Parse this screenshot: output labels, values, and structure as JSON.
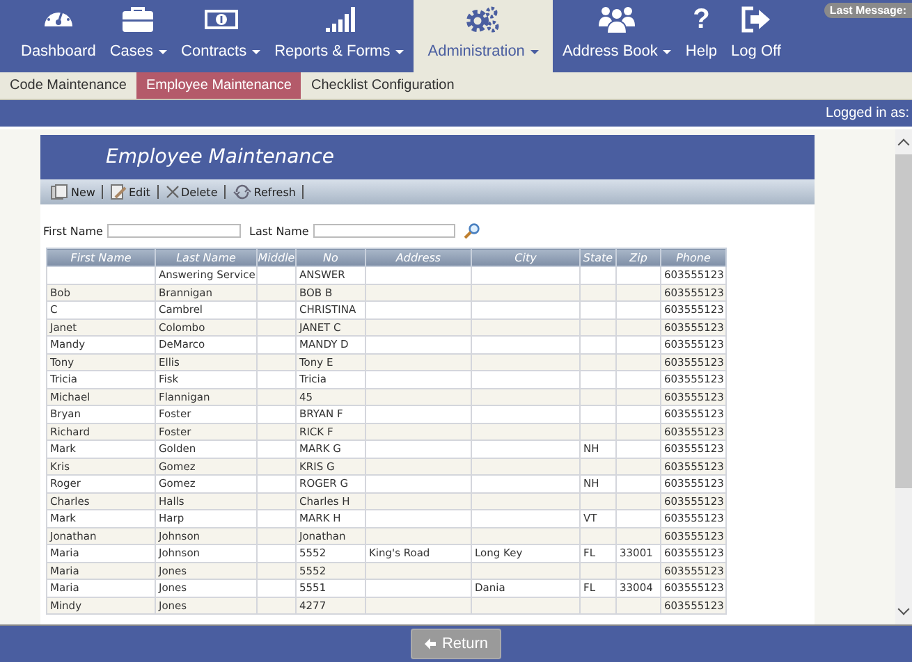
{
  "nav": {
    "items": [
      {
        "label": "Dashboard",
        "caret": false,
        "selected": false
      },
      {
        "label": "Cases",
        "caret": true,
        "selected": false
      },
      {
        "label": "Contracts",
        "caret": true,
        "selected": false
      },
      {
        "label": "Reports & Forms",
        "caret": true,
        "selected": false
      },
      {
        "label": "Administration",
        "caret": true,
        "selected": true
      },
      {
        "label": "Address Book",
        "caret": true,
        "selected": false
      },
      {
        "label": "Help",
        "glyph": "?",
        "caret": false,
        "selected": false
      },
      {
        "label": "Log Off",
        "caret": false,
        "selected": false
      }
    ],
    "last_message": "Last Message:"
  },
  "subnav": [
    {
      "label": "Code Maintenance",
      "selected": false
    },
    {
      "label": "Employee Maintenance",
      "selected": true
    },
    {
      "label": "Checklist Configuration",
      "selected": false
    }
  ],
  "user_bar": {
    "text": "Logged in as:"
  },
  "panel": {
    "title": "Employee Maintenance",
    "toolbar": [
      {
        "label": "New"
      },
      {
        "label": "Edit"
      },
      {
        "label": "Delete"
      },
      {
        "label": "Refresh"
      }
    ],
    "filters": [
      {
        "label": "First Name"
      },
      {
        "label": "Last Name"
      }
    ],
    "table": {
      "columns": [
        "First Name",
        "Last Name",
        "Middle",
        "No",
        "Address",
        "City",
        "State",
        "Zip",
        "Phone"
      ],
      "rows": [
        {
          "last_name": "Answering Service",
          "no": "ANSWER",
          "phone": "603555123"
        },
        {
          "first_name": "Bob",
          "last_name": "Brannigan",
          "no": "BOB B",
          "phone": "603555123"
        },
        {
          "first_name": "C",
          "last_name": "Cambrel",
          "no": "CHRISTINA",
          "phone": "603555123"
        },
        {
          "first_name": "Janet",
          "last_name": "Colombo",
          "no": "JANET C",
          "phone": "603555123"
        },
        {
          "first_name": "Mandy",
          "last_name": "DeMarco",
          "no": "MANDY D",
          "phone": "603555123"
        },
        {
          "first_name": "Tony",
          "last_name": "Ellis",
          "no": "Tony E",
          "phone": "603555123"
        },
        {
          "first_name": "Tricia",
          "last_name": "Fisk",
          "no": "Tricia",
          "phone": "603555123"
        },
        {
          "first_name": "Michael",
          "last_name": "Flannigan",
          "no": "45",
          "phone": "603555123"
        },
        {
          "first_name": "Bryan",
          "last_name": "Foster",
          "no": "BRYAN F",
          "phone": "603555123"
        },
        {
          "first_name": "Richard",
          "last_name": "Foster",
          "no": "RICK F",
          "phone": "603555123"
        },
        {
          "first_name": "Mark",
          "last_name": "Golden",
          "no": "MARK G",
          "state": "NH",
          "phone": "603555123"
        },
        {
          "first_name": "Kris",
          "last_name": "Gomez",
          "no": "KRIS G",
          "phone": "603555123"
        },
        {
          "first_name": "Roger",
          "last_name": "Gomez",
          "no": "ROGER G",
          "state": "NH",
          "phone": "603555123"
        },
        {
          "first_name": "Charles",
          "last_name": "Halls",
          "no": "Charles H",
          "phone": "603555123"
        },
        {
          "first_name": "Mark",
          "last_name": "Harp",
          "no": "MARK H",
          "state": "VT",
          "phone": "603555123"
        },
        {
          "first_name": "Jonathan",
          "last_name": "Johnson",
          "no": "Jonathan",
          "phone": "603555123"
        },
        {
          "first_name": "Maria",
          "last_name": "Johnson",
          "no": "5552",
          "address": "King's Road",
          "city": "Long Key",
          "state": "FL",
          "zip": "33001",
          "phone": "603555123"
        },
        {
          "first_name": "Maria",
          "last_name": "Jones",
          "no": "5552",
          "phone": "603555123"
        },
        {
          "first_name": "Maria",
          "last_name": "Jones",
          "no": "5551",
          "city": "Dania",
          "state": "FL",
          "zip": "33004",
          "phone": "603555123"
        },
        {
          "first_name": "Mindy",
          "last_name": "Jones",
          "no": "4277",
          "phone": "603555123"
        }
      ]
    }
  },
  "footer": {
    "button": "Return"
  }
}
